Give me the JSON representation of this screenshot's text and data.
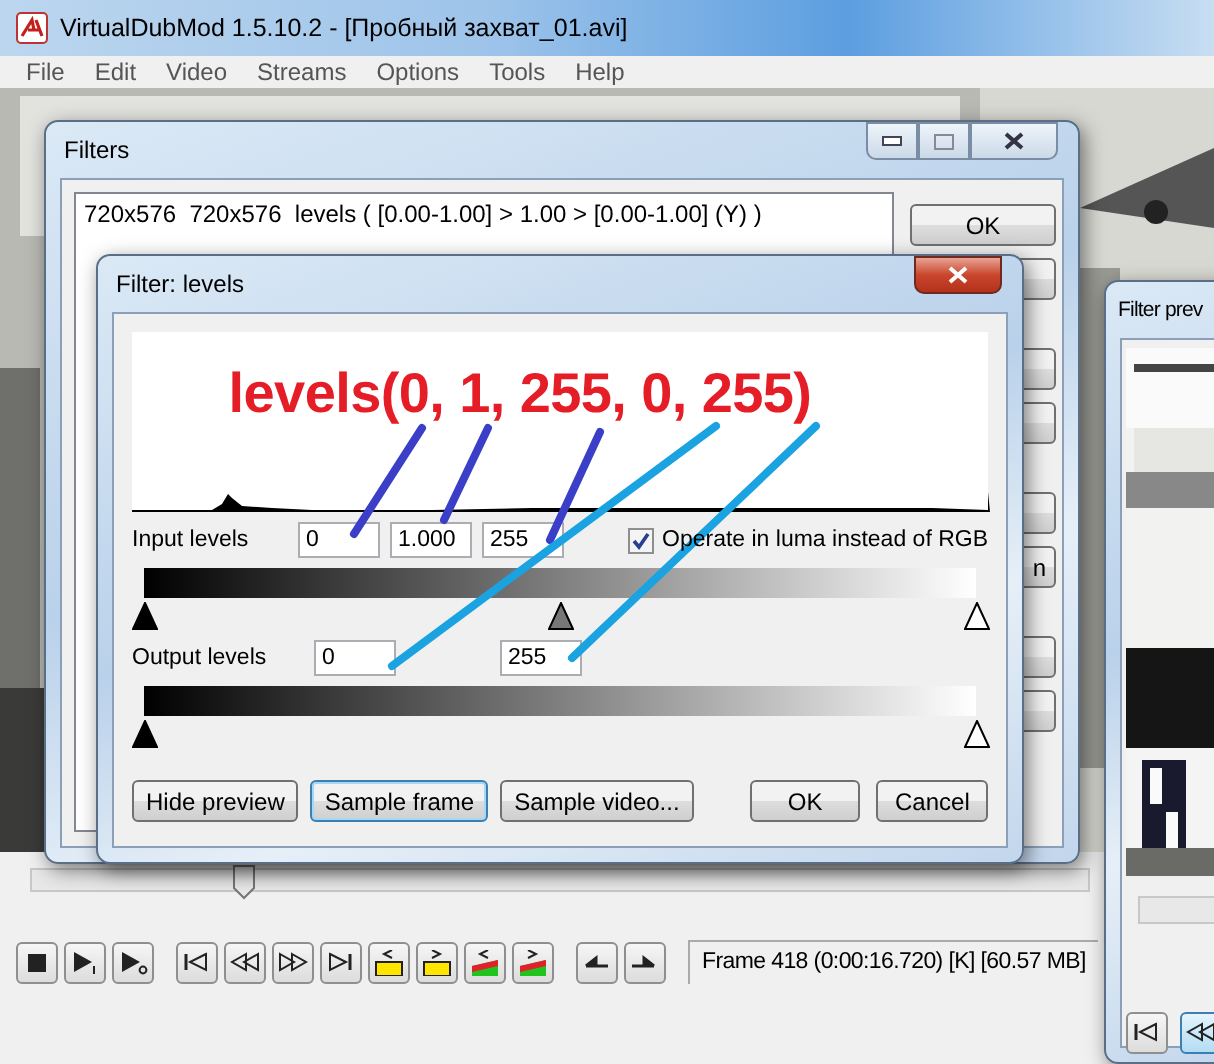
{
  "window": {
    "title": "VirtualDubMod 1.5.10.2 - [Пробный захват_01.avi]"
  },
  "menu": [
    "File",
    "Edit",
    "Video",
    "Streams",
    "Options",
    "Tools",
    "Help"
  ],
  "filters_dialog": {
    "title": "Filters",
    "list": [
      {
        "text": "720x576  720x576  levels ( [0.00-1.00] > 1.00 > [0.00-1.00] (Y) )",
        "selected": false
      }
    ],
    "button_groups": [
      [
        {
          "kind": "shown",
          "label": "OK"
        },
        {
          "kind": "covered"
        }
      ],
      [
        {
          "kind": "covered"
        },
        {
          "kind": "covered"
        }
      ],
      [
        {
          "kind": "covered"
        },
        {
          "kind": "covered",
          "label": "n"
        }
      ],
      [
        {
          "kind": "covered"
        },
        {
          "kind": "covered"
        }
      ]
    ]
  },
  "levels_dialog": {
    "title": "Filter: levels",
    "annotation": "levels(0, 1, 255, 0, 255)",
    "input_label": "Input levels",
    "input_fields": [
      "0",
      "1.000",
      "255"
    ],
    "luma": {
      "label": "Operate in luma instead of RGB",
      "checked": true
    },
    "input_handles": [
      {
        "kind": "black",
        "level": 0
      },
      {
        "kind": "gray",
        "level": 0.5
      },
      {
        "kind": "white",
        "level": 1
      }
    ],
    "output_label": "Output levels",
    "output_fields": [
      "0",
      "255"
    ],
    "output_handles": [
      {
        "kind": "black",
        "level": 0
      },
      {
        "kind": "white",
        "level": 1
      }
    ],
    "buttons": [
      {
        "label": "Hide preview",
        "focused": false
      },
      {
        "label": "Sample frame",
        "focused": true
      },
      {
        "label": "Sample video...",
        "focused": false
      }
    ],
    "dialog_buttons": [
      {
        "label": "OK",
        "focused": false
      },
      {
        "label": "Cancel",
        "focused": false
      }
    ]
  },
  "preview_window": {
    "title": "Filter prev",
    "buttons": [
      {
        "kind": "start",
        "selected": false
      },
      {
        "kind": "prev",
        "selected": true
      }
    ]
  },
  "timeline": {
    "level": 0.2
  },
  "toolbar": [
    {
      "kind": "stop"
    },
    {
      "kind": "play_input"
    },
    {
      "kind": "play_output"
    },
    {
      "kind": "start"
    },
    {
      "kind": "prev"
    },
    {
      "kind": "next"
    },
    {
      "kind": "end"
    },
    {
      "kind": "key_prev"
    },
    {
      "kind": "key_next"
    },
    {
      "kind": "scene_prev"
    },
    {
      "kind": "scene_next"
    },
    {
      "kind": "mark_in"
    },
    {
      "kind": "mark_out"
    }
  ],
  "status": "Frame 418 (0:00:16.720) [K] [60.57 MB]"
}
